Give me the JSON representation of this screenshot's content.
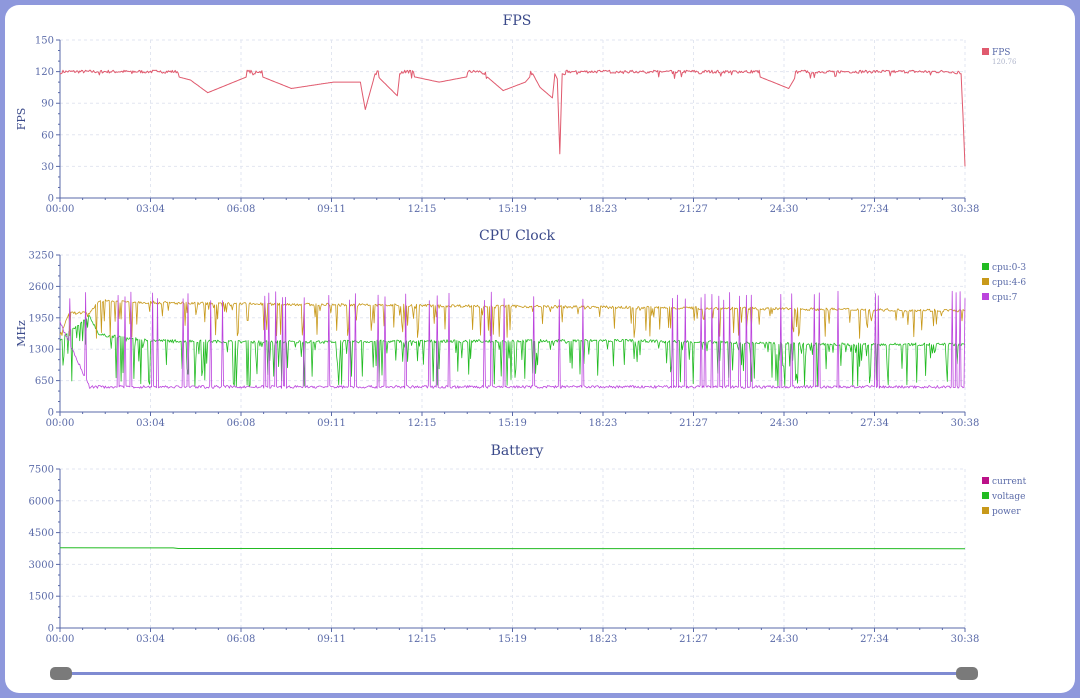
{
  "x_tick_labels": [
    "00:00",
    "03:04",
    "06:08",
    "09:11",
    "12:15",
    "15:19",
    "18:23",
    "21:27",
    "24:30",
    "27:34",
    "30:38"
  ],
  "chart_data": [
    {
      "type": "line",
      "title": "FPS",
      "ylabel": "FPS",
      "xlabel": "",
      "ylim": [
        0,
        150
      ],
      "yticks": [
        0,
        30,
        60,
        90,
        120,
        150
      ],
      "xlim_seconds": [
        0,
        1838
      ],
      "grid": true,
      "legend_placement": "right",
      "series": [
        {
          "name": "FPS",
          "legend_value": "120.76",
          "color": "#e05a6e",
          "baseline": 120,
          "x": [
            0,
            200,
            265,
            300,
            395,
            470,
            555,
            610,
            620,
            640,
            685,
            690,
            770,
            860,
            900,
            945,
            960,
            975,
            1000,
            1005,
            1010,
            1015,
            1020,
            1025,
            1040,
            1100,
            1200,
            1300,
            1400,
            1480,
            1500,
            1600,
            1700,
            1800,
            1820,
            1830,
            1834,
            1838
          ],
          "y": [
            118,
            120,
            112,
            100,
            118,
            104,
            110,
            110,
            84,
            118,
            97,
            118,
            110,
            118,
            102,
            110,
            118,
            105,
            95,
            118,
            113,
            42,
            118,
            117,
            120,
            120,
            120,
            118,
            119,
            104,
            120,
            120,
            120,
            120,
            118,
            118,
            78,
            30
          ]
        }
      ]
    },
    {
      "type": "line",
      "title": "CPU Clock",
      "ylabel": "MHz",
      "xlabel": "",
      "ylim": [
        0,
        3250
      ],
      "yticks": [
        0,
        650,
        1300,
        1950,
        2600,
        3250
      ],
      "xlim_seconds": [
        0,
        1838
      ],
      "grid": true,
      "legend_placement": "right",
      "series": [
        {
          "name": "cpu:0-3",
          "color": "#22bb22",
          "base": [
            [
              0,
              1500
            ],
            [
              60,
              1980
            ],
            [
              80,
              1600
            ],
            [
              180,
              1480
            ],
            [
              390,
              1450
            ],
            [
              1140,
              1480
            ],
            [
              1560,
              1400
            ],
            [
              1838,
              1400
            ]
          ],
          "low": 520,
          "dip_prob": 0.55
        },
        {
          "name": "cpu:4-6",
          "color": "#c8991a",
          "base": [
            [
              0,
              1600
            ],
            [
              20,
              2050
            ],
            [
              60,
              2050
            ],
            [
              80,
              2300
            ],
            [
              250,
              2250
            ],
            [
              1838,
              2100
            ]
          ],
          "low": 1500,
          "dip_prob": 0.35
        },
        {
          "name": "cpu:7",
          "color": "#bb44dd",
          "base": [
            [
              0,
              1850
            ],
            [
              60,
              520
            ],
            [
              1838,
              520
            ]
          ],
          "high": 2300,
          "spike_prob": 0.25
        }
      ]
    },
    {
      "type": "line",
      "title": "Battery",
      "ylabel": "",
      "xlabel": "",
      "ylim": [
        0,
        7500
      ],
      "yticks": [
        0,
        1500,
        3000,
        4500,
        6000,
        7500
      ],
      "xlim_seconds": [
        0,
        1838
      ],
      "grid": true,
      "legend_placement": "right",
      "series": [
        {
          "name": "current",
          "color": "#bb1188",
          "x": [],
          "y": []
        },
        {
          "name": "voltage",
          "color": "#22bb22",
          "x": [
            0,
            230,
            240,
            1838
          ],
          "y": [
            3790,
            3780,
            3750,
            3740
          ]
        },
        {
          "name": "power",
          "color": "#c8991a",
          "x": [],
          "y": []
        }
      ]
    }
  ],
  "slider": {
    "start": 0.0,
    "end": 1.0
  }
}
